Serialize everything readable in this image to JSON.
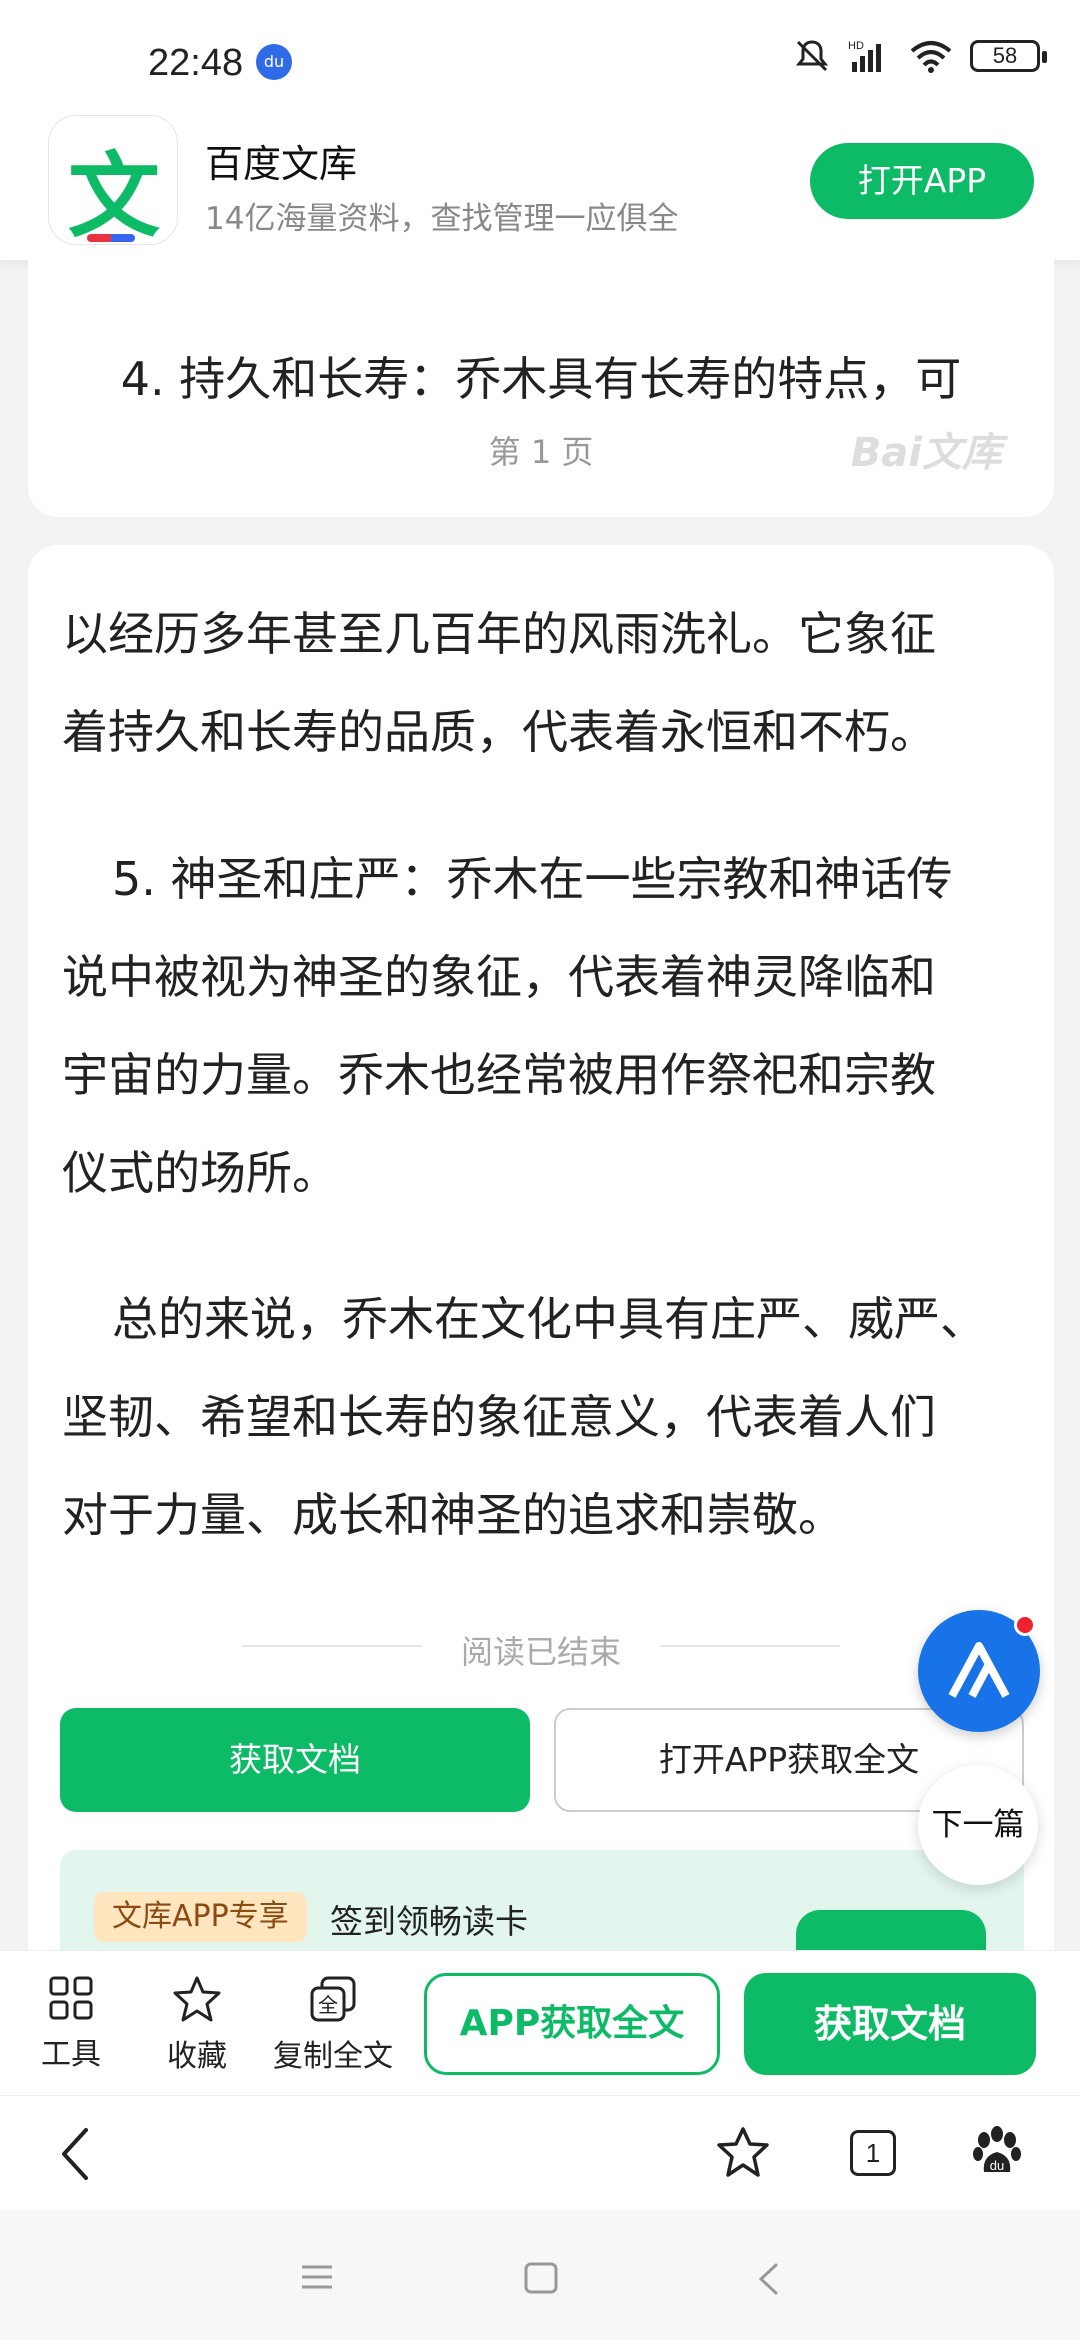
{
  "status": {
    "time": "22:48",
    "battery": "58",
    "network": "HD"
  },
  "banner": {
    "logo_char": "文",
    "title": "百度文库",
    "subtitle": "14亿海量资料，查找管理一应俱全",
    "open_app": "打开APP"
  },
  "page1": {
    "text": "4. 持久和长寿：乔木具有长寿的特点，可",
    "page_label": "第 1 页",
    "watermark": "Bai文库"
  },
  "content": {
    "p1_l1": "以经历多年甚至几百年的风雨洗礼。它象征",
    "p1_l2": "着持久和长寿的品质，代表着永恒和不朽。",
    "p2_l1": "5. 神圣和庄严：乔木在一些宗教和神话传",
    "p2_l2": "说中被视为神圣的象征，代表着神灵降临和",
    "p2_l3": "宇宙的力量。乔木也经常被用作祭祀和宗教",
    "p2_l4": "仪式的场所。",
    "p3_l1": "总的来说，乔木在文化中具有庄严、威严、",
    "p3_l2": "坚韧、希望和长寿的象征意义，代表着人们",
    "p3_l3": "对于力量、成长和神圣的追求和崇敬。",
    "end_text": "阅读已结束"
  },
  "actions": {
    "get_doc": "获取文档",
    "open_full": "打开APP获取全文",
    "next": "下一篇"
  },
  "promo": {
    "tag": "文库APP专享",
    "text": "签到领畅读卡"
  },
  "toolbar": {
    "tools": "工具",
    "favorite": "收藏",
    "copy_all": "复制全文",
    "app_full": "APP获取全文",
    "get_doc": "获取文档"
  },
  "browser": {
    "tab_count": "1"
  },
  "colors": {
    "brand_green": "#0dbb66",
    "ai_blue": "#1973e8"
  }
}
